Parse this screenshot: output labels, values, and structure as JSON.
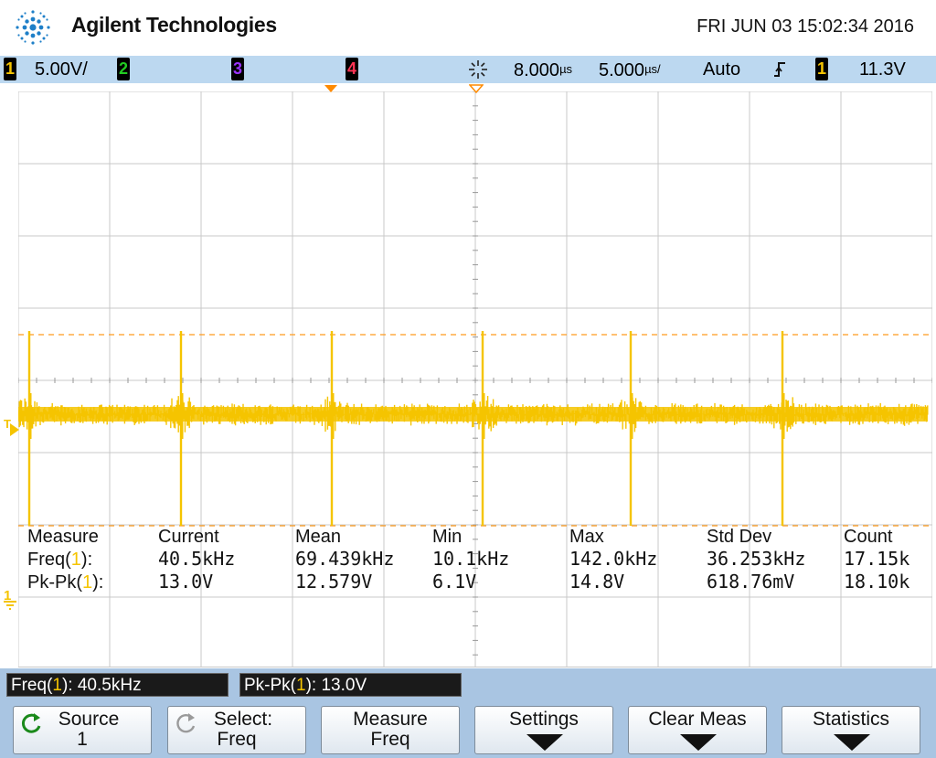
{
  "header": {
    "brand": "Agilent Technologies",
    "datetime": "FRI JUN 03 15:02:34 2016"
  },
  "status": {
    "ch1": {
      "num": "1",
      "scale": "5.00V/",
      "color": "#f5c400"
    },
    "ch2": {
      "num": "2",
      "color": "#22cc22"
    },
    "ch3": {
      "num": "3",
      "color": "#9a33ff"
    },
    "ch4": {
      "num": "4",
      "color": "#ff3355"
    },
    "time_delay": "8.000",
    "delay_unit": "µs",
    "time_scale": "5.000",
    "scale_unit": "µs/",
    "trigger_mode": "Auto",
    "trigger_slope_icon": "rising-edge-icon",
    "trigger_source": "1",
    "trigger_level": "11.3V"
  },
  "measurements": {
    "headers": [
      "Measure",
      "Current",
      "Mean",
      "Min",
      "Max",
      "Std Dev",
      "Count"
    ],
    "rows": [
      {
        "name": "Freq(",
        "ch": "1",
        "suffix": "):",
        "values": [
          "40.5kHz",
          "69.439kHz",
          "10.1kHz",
          "142.0kHz",
          "36.253kHz",
          "17.15k"
        ]
      },
      {
        "name": "Pk-Pk(",
        "ch": "1",
        "suffix": "):",
        "values": [
          "13.0V",
          "12.579V",
          "6.1V",
          "14.8V",
          "618.76mV",
          "18.10k"
        ]
      }
    ]
  },
  "markers": {
    "trigger_label": "T",
    "ground_label": "1"
  },
  "readouts": {
    "freq": {
      "name": "Freq(",
      "ch": "1",
      "suffix": "): 40.5kHz"
    },
    "pkpk": {
      "name": "Pk-Pk(",
      "ch": "1",
      "suffix": "): 13.0V"
    }
  },
  "softkeys": {
    "source": {
      "line1": "Source",
      "line2": "1"
    },
    "select": {
      "line1": "Select:",
      "line2": "Freq"
    },
    "measure": {
      "line1": "Measure",
      "line2": "Freq"
    },
    "settings": {
      "line1": "Settings"
    },
    "clear": {
      "line1": "Clear Meas"
    },
    "statistics": {
      "line1": "Statistics"
    }
  },
  "colors": {
    "trace": "#f5c400",
    "grid": "#c8c8c8",
    "status_bar": "#bcd8f0",
    "softkey_area": "#a9c5e2"
  }
}
